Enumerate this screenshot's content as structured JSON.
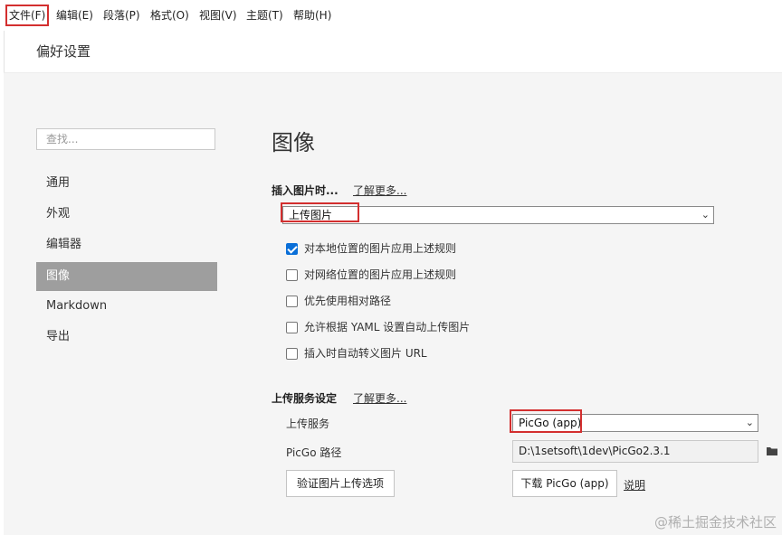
{
  "menu": {
    "items": [
      "文件(F)",
      "编辑(E)",
      "段落(P)",
      "格式(O)",
      "视图(V)",
      "主题(T)",
      "帮助(H)"
    ]
  },
  "preferences": {
    "title": "偏好设置"
  },
  "sidebar": {
    "search_placeholder": "查找...",
    "items": [
      {
        "label": "通用",
        "active": false
      },
      {
        "label": "外观",
        "active": false
      },
      {
        "label": "编辑器",
        "active": false
      },
      {
        "label": "图像",
        "active": true
      },
      {
        "label": "Markdown",
        "active": false
      },
      {
        "label": "导出",
        "active": false
      }
    ]
  },
  "main": {
    "title": "图像",
    "insert_label": "插入图片时...",
    "learn_more": "了解更多...",
    "insert_action": "上传图片",
    "options": [
      {
        "label": "对本地位置的图片应用上述规则",
        "checked": true
      },
      {
        "label": "对网络位置的图片应用上述规则",
        "checked": false
      },
      {
        "label": "优先使用相对路径",
        "checked": false
      },
      {
        "label": "允许根据 YAML 设置自动上传图片",
        "checked": false
      },
      {
        "label": "插入时自动转义图片 URL",
        "checked": false
      }
    ],
    "upload_settings_label": "上传服务设定",
    "upload_learn_more": "了解更多...",
    "upload_service_label": "上传服务",
    "upload_service_value": "PicGo (app)",
    "picgo_path_label": "PicGo 路径",
    "picgo_path_value": "D:\\1setsoft\\1dev\\PicGo2.3.1",
    "verify_button": "验证图片上传选项",
    "download_button": "下载 PicGo (app)",
    "help_link": "说明"
  },
  "watermark": "@稀土掘金技术社区",
  "colors": {
    "highlight_box": "#d32f2f",
    "active_nav": "#9e9e9e",
    "checkbox_checked": "#0a6fd8"
  }
}
